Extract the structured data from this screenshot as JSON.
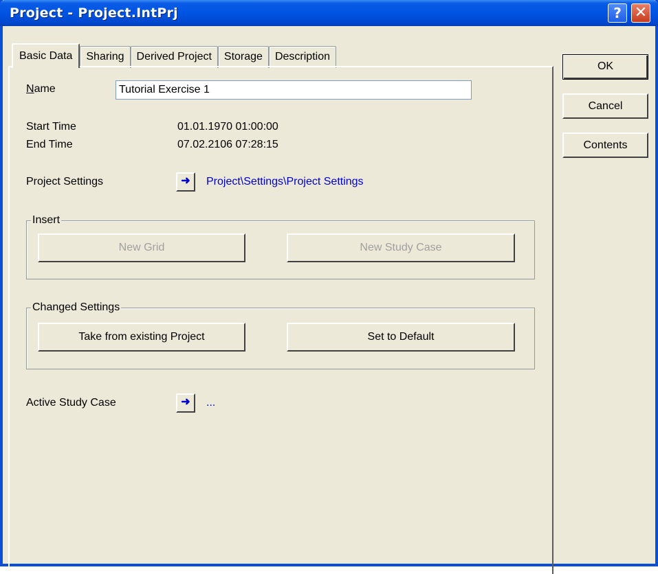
{
  "window": {
    "title": "Project - Project.IntPrj"
  },
  "titlebar": {
    "help_icon": "?",
    "close_icon": "✕"
  },
  "tabs": [
    {
      "label": "Basic Data",
      "active": true
    },
    {
      "label": "Sharing"
    },
    {
      "label": "Derived Project"
    },
    {
      "label": "Storage"
    },
    {
      "label": "Description"
    }
  ],
  "dialog_buttons": {
    "ok": "OK",
    "cancel": "Cancel",
    "contents": "Contents"
  },
  "basic": {
    "name_label_u": "N",
    "name_label_rest": "ame",
    "name_value": "Tutorial Exercise 1",
    "start_label": "Start Time",
    "start_value": "01.01.1970 01:00:00",
    "end_label": "End Time",
    "end_value": "07.02.2106 07:28:15",
    "settings_label": "Project Settings",
    "settings_link": "Project\\Settings\\Project Settings",
    "arrow_glyph": "➜",
    "insert_title": "Insert",
    "new_grid": "New Grid",
    "new_study_case": "New Study Case",
    "changed_title": "Changed Settings",
    "take_from": "Take from existing Project",
    "set_default": "Set to Default",
    "active_case_label": "Active Study Case",
    "active_case_value": "..."
  }
}
